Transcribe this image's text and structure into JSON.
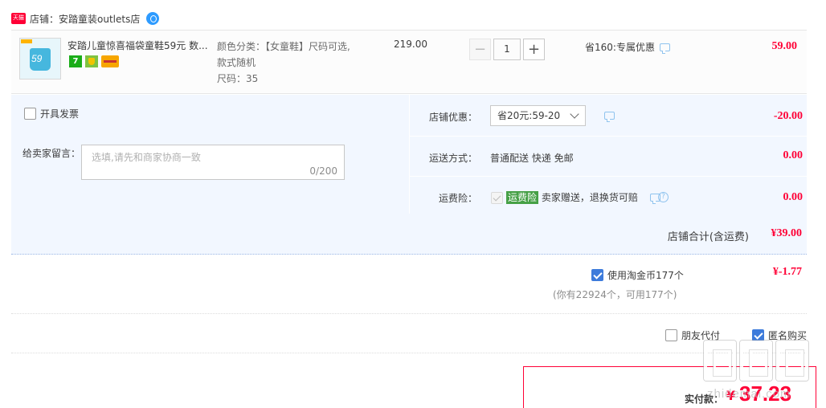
{
  "shop": {
    "badge": "天猫",
    "label": "店铺：安踏童装outlets店"
  },
  "item": {
    "thumb_number": "59",
    "title": "安踏儿童惊喜福袋童鞋59元 数...",
    "sku_lines": [
      "颜色分类：【女童鞋】尺码可选,",
      "款式随机",
      "尺码：35"
    ],
    "unit_price": "219.00",
    "quantity": "1",
    "qty_minus": "−",
    "qty_plus": "+",
    "promo": "省160:专属优惠",
    "total": "59.00",
    "service_7": "7"
  },
  "invoice": {
    "label": "开具发票",
    "checked": false
  },
  "memo": {
    "label": "给卖家留言：",
    "placeholder": "选填,请先和商家协商一致",
    "count": "0/200"
  },
  "shop_discount": {
    "label": "店铺优惠：",
    "selected": "省20元:59-20",
    "value": "-20.00"
  },
  "shipping": {
    "label": "运送方式：",
    "method": "普通配送 快递 免邮",
    "value": "0.00"
  },
  "insurance": {
    "label": "运费险：",
    "tag": "运费险",
    "desc": "卖家赠送，退换货可赔",
    "help": "?",
    "value": "0.00"
  },
  "shop_total": {
    "label": "店铺合计(含运费)",
    "value": "¥39.00"
  },
  "coins": {
    "label": "使用淘金币177个",
    "note": "(你有22924个，可用177个)",
    "value": "¥-1.77",
    "checked": true
  },
  "pay_options": {
    "friend_pay": "朋友代付",
    "anonymous": "匿名购买"
  },
  "payment": {
    "label": "实付款：",
    "currency": "¥",
    "amount": "37.23"
  },
  "watermark": {
    "text": "zhidemai.com"
  },
  "colors": {
    "accent": "#ff0036",
    "panel_bg": "#f2f7ff",
    "check_blue": "#3d7bdb",
    "insurance_green": "#46a046"
  }
}
